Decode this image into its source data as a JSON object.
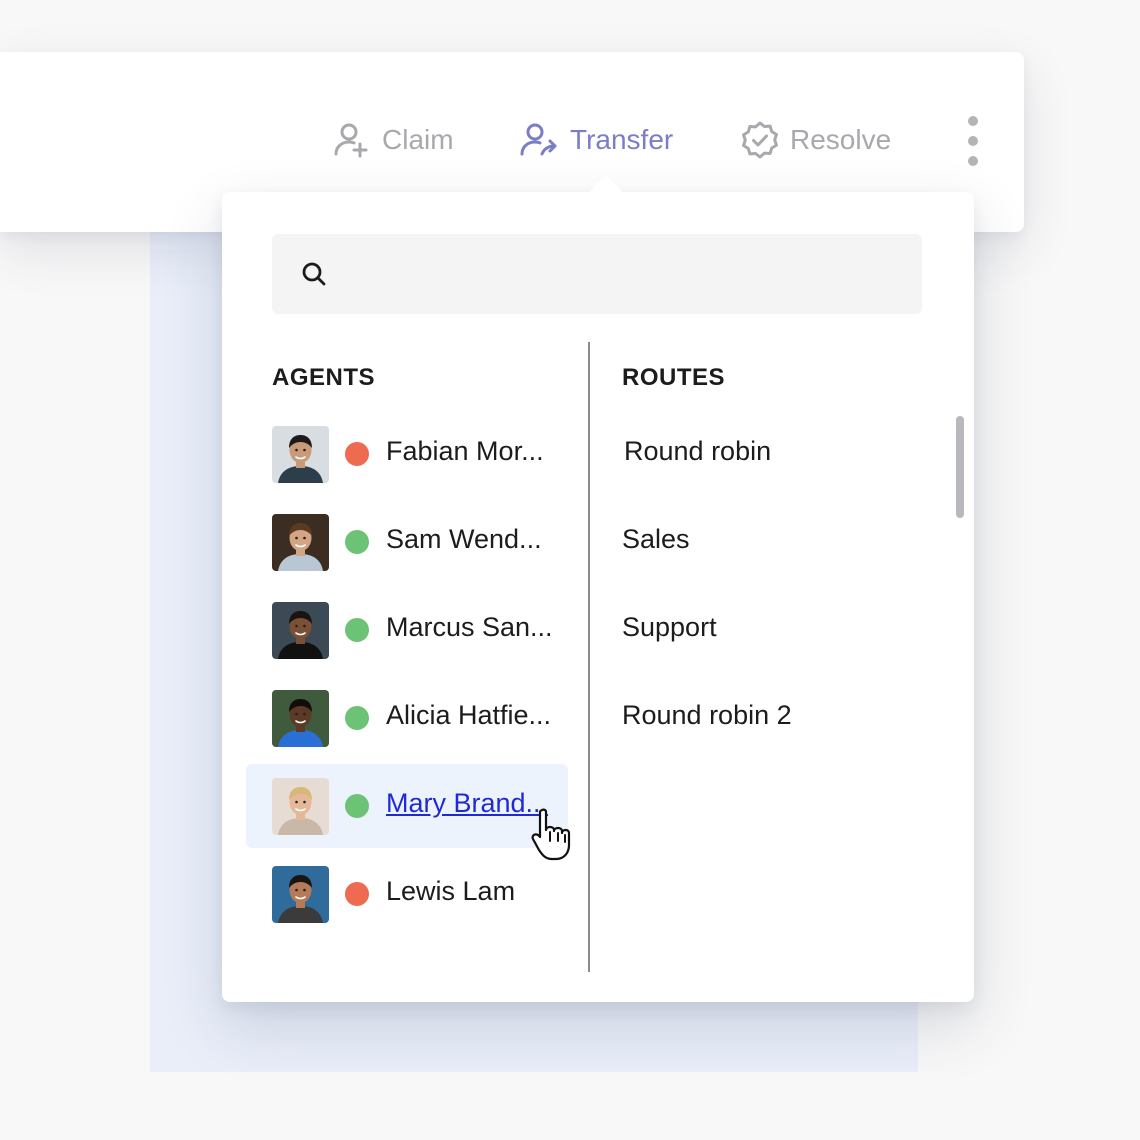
{
  "toolbar": {
    "claim_label": "Claim",
    "transfer_label": "Transfer",
    "resolve_label": "Resolve"
  },
  "search": {
    "placeholder": ""
  },
  "agents": {
    "heading": "AGENTS",
    "items": [
      {
        "name": "Fabian Mor...",
        "status": "away",
        "status_color": "#ee6a50",
        "skin": "#c99a78",
        "hair": "#1f1a17",
        "shirt": "#2c3e4a",
        "bg": "#d8dde2"
      },
      {
        "name": "Sam Wend...",
        "status": "online",
        "status_color": "#6cc375",
        "skin": "#d4a584",
        "hair": "#5a3b22",
        "shirt": "#b9c7d4",
        "bg": "#3b2d22"
      },
      {
        "name": "Marcus San...",
        "status": "online",
        "status_color": "#6cc375",
        "skin": "#7a5037",
        "hair": "#1a1410",
        "shirt": "#111111",
        "bg": "#3b4a55"
      },
      {
        "name": "Alicia Hatfie...",
        "status": "online",
        "status_color": "#6cc375",
        "skin": "#5b3a26",
        "hair": "#120d0a",
        "shirt": "#2a6fd6",
        "bg": "#3f5a3c"
      },
      {
        "name": "Mary Brand...",
        "status": "online",
        "status_color": "#6cc375",
        "skin": "#e5b898",
        "hair": "#d9b77a",
        "shirt": "#c9b8a8",
        "bg": "#e6dcd4"
      },
      {
        "name": "Lewis Lam",
        "status": "away",
        "status_color": "#ee6a50",
        "skin": "#b57a58",
        "hair": "#1c1410",
        "shirt": "#3b3b3b",
        "bg": "#2f6c9b"
      }
    ]
  },
  "routes": {
    "heading": "ROUTES",
    "items": [
      "Round robin",
      "Sales",
      "Support",
      "Round robin 2"
    ]
  },
  "colors": {
    "accent": "#7b7dc6",
    "muted": "#a8a8ad",
    "link": "#1f2ad6",
    "hover_row": "#edf3fd",
    "status_online": "#6cc375",
    "status_away": "#ee6a50"
  },
  "icons": {
    "claim": "user-plus-icon",
    "transfer": "user-transfer-icon",
    "resolve": "badge-check-icon",
    "more": "vertical-dots-icon",
    "search": "search-icon",
    "cursor": "hand-pointer-icon"
  }
}
